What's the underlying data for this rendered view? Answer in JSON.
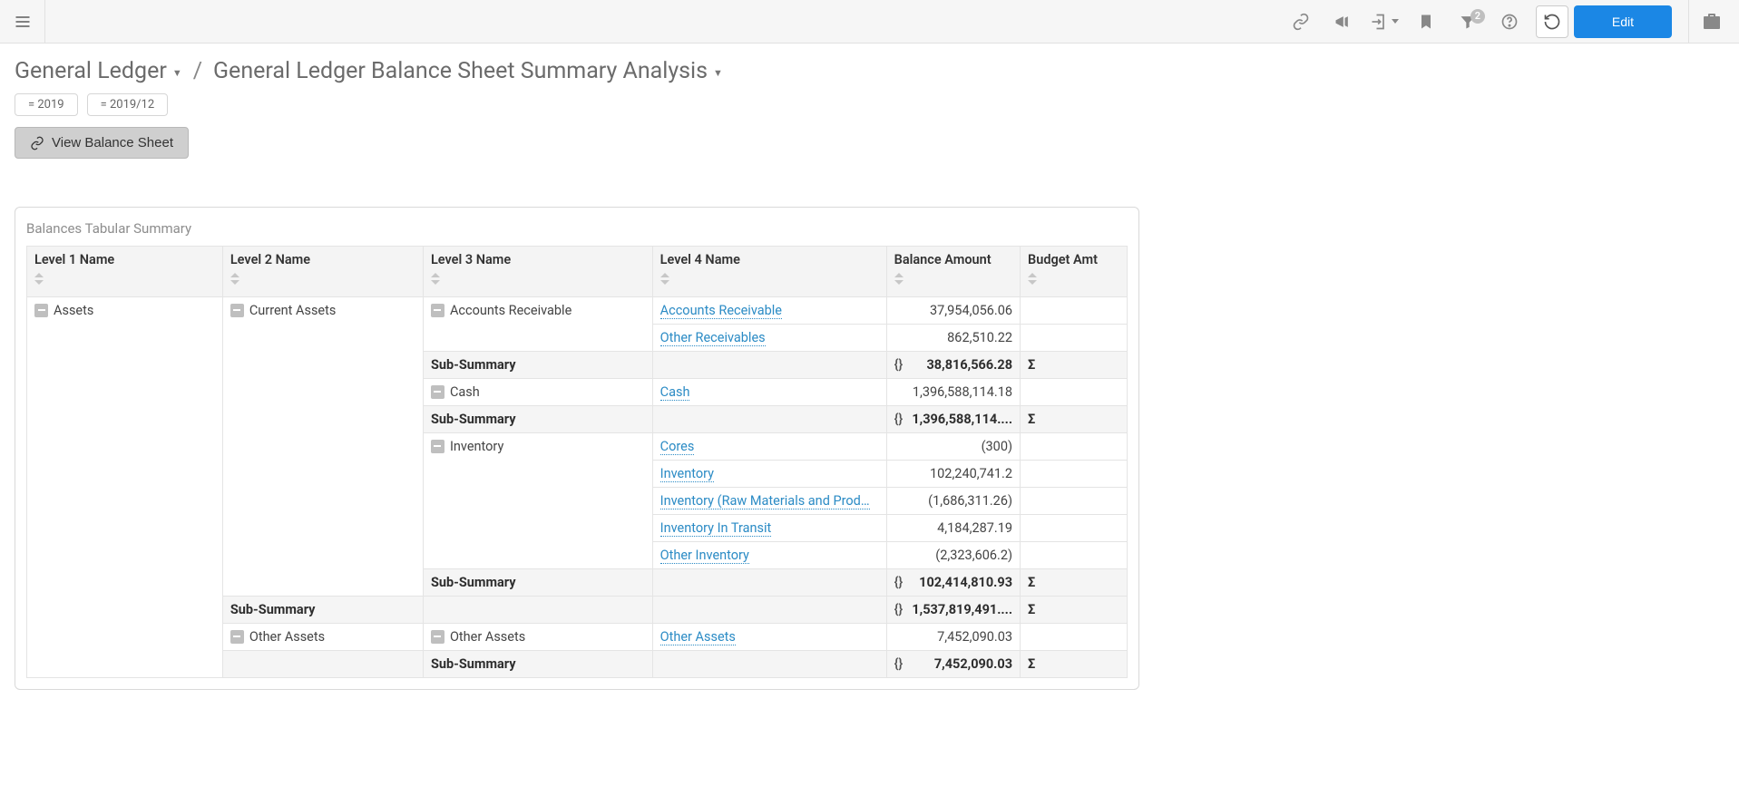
{
  "toolbar": {
    "filter_count": "2",
    "edit_label": "Edit"
  },
  "breadcrumb": {
    "root": "General Ledger",
    "page": "General Ledger Balance Sheet Summary Analysis"
  },
  "filters": {
    "year": "= 2019",
    "period": "= 2019/12"
  },
  "action": {
    "view_balance_sheet": "View Balance Sheet"
  },
  "card": {
    "title": "Balances Tabular Summary"
  },
  "columns": {
    "l1": "Level 1 Name",
    "l2": "Level 2 Name",
    "l3": "Level 3 Name",
    "l4": "Level 4 Name",
    "bal": "Balance Amount",
    "bud": "Budget Amt"
  },
  "labels": {
    "sub_summary": "Sub-Summary",
    "sigma": "Σ"
  },
  "tree": {
    "l1_assets": "Assets",
    "l2_current_assets": "Current Assets",
    "l2_other_assets": "Other Assets",
    "l3_ar": "Accounts Receivable",
    "l3_cash": "Cash",
    "l3_inventory": "Inventory",
    "l3_other_assets": "Other Assets"
  },
  "rows": {
    "ar_ar": {
      "l4": "Accounts Receivable",
      "bal": "37,954,056.06"
    },
    "ar_other": {
      "l4": "Other Receivables",
      "bal": "862,510.22"
    },
    "ar_sub": {
      "bal": "38,816,566.28"
    },
    "cash_cash": {
      "l4": "Cash",
      "bal": "1,396,588,114.18"
    },
    "cash_sub": {
      "bal": "1,396,588,114...."
    },
    "inv_cores": {
      "l4": "Cores",
      "bal": "(300)"
    },
    "inv_inv": {
      "l4": "Inventory",
      "bal": "102,240,741.2"
    },
    "inv_raw": {
      "l4": "Inventory (Raw Materials and Prod…",
      "bal": "(1,686,311.26)"
    },
    "inv_transit": {
      "l4": "Inventory In Transit",
      "bal": "4,184,287.19"
    },
    "inv_other": {
      "l4": "Other Inventory",
      "bal": "(2,323,606.2)"
    },
    "inv_sub": {
      "bal": "102,414,810.93"
    },
    "ca_sub": {
      "bal": "1,537,819,491...."
    },
    "oa_oa": {
      "l4": "Other Assets",
      "bal": "7,452,090.03"
    },
    "oa_sub": {
      "bal": "7,452,090.03"
    }
  }
}
